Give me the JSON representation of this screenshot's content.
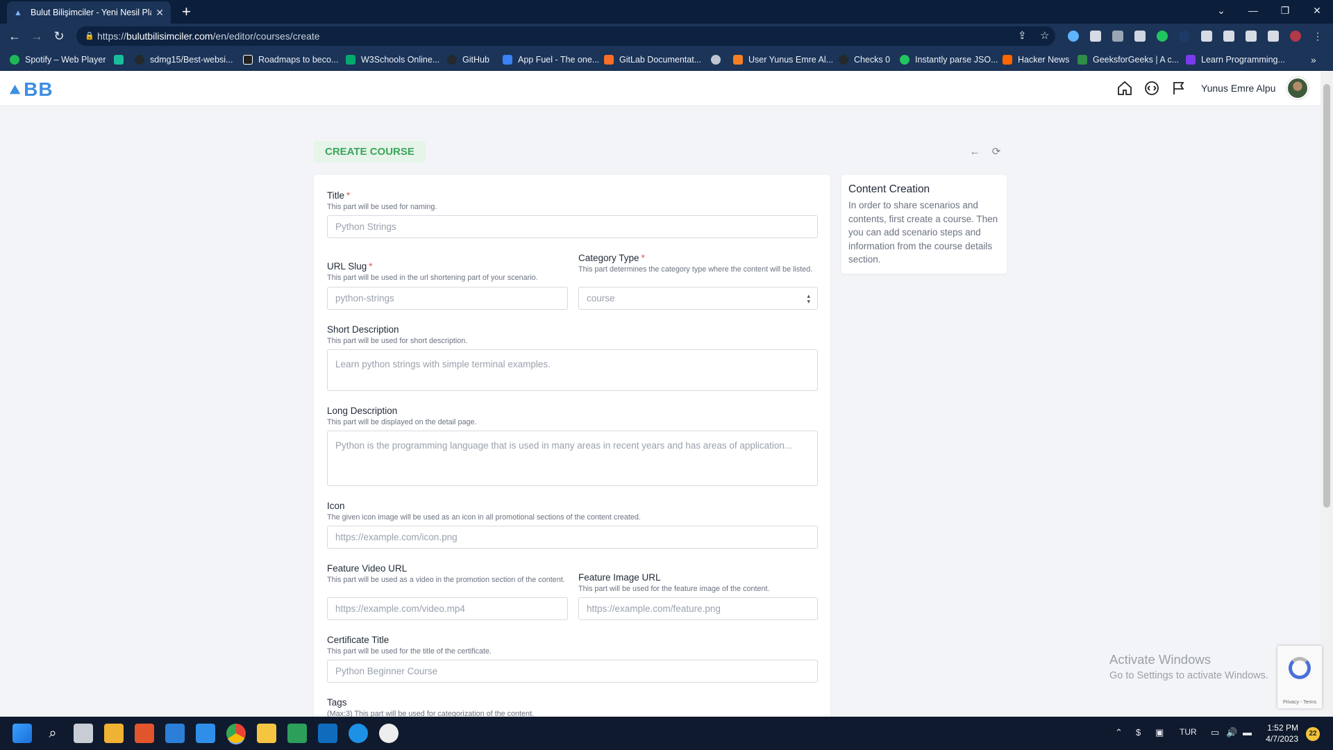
{
  "browser": {
    "tab_title": "Bulut Bilişimciler - Yeni Nesil Platf",
    "url_prefix": "https://",
    "url_host": "bulutbilisimciler.com",
    "url_path": "/en/editor/courses/create",
    "bookmarks": [
      {
        "label": "Spotify – Web Player",
        "color": "#1db954"
      },
      {
        "label": "",
        "color": "#1abc9c"
      },
      {
        "label": "sdmg15/Best-websi...",
        "color": "#24292e"
      },
      {
        "label": "Roadmaps to beco...",
        "color": "#222222"
      },
      {
        "label": "W3Schools Online...",
        "color": "#04aa6d"
      },
      {
        "label": "GitHub",
        "color": "#24292e"
      },
      {
        "label": "App Fuel - The one...",
        "color": "#3b82f6"
      },
      {
        "label": "GitLab Documentat...",
        "color": "#fc6d26"
      },
      {
        "label": "",
        "color": "#c0c7d2"
      },
      {
        "label": "User Yunus Emre Al...",
        "color": "#f48024"
      },
      {
        "label": "Checks 0",
        "color": "#24292e"
      },
      {
        "label": "Instantly parse JSO...",
        "color": "#22c55e"
      },
      {
        "label": "Hacker News",
        "color": "#ff6600"
      },
      {
        "label": "GeeksforGeeks | A c...",
        "color": "#2f8d46"
      },
      {
        "label": "Learn Programming...",
        "color": "#7c3aed"
      }
    ]
  },
  "app": {
    "logo_text": "BB",
    "user_name": "Yunus Emre Alpu",
    "page_badge": "CREATE COURSE",
    "form": {
      "title_label": "Title",
      "title_hint": "This part will be used for naming.",
      "title_placeholder": "Python Strings",
      "slug_label": "URL Slug",
      "slug_hint": "This part will be used in the url shortening part of your scenario.",
      "slug_placeholder": "python-strings",
      "category_label": "Category Type",
      "category_hint": "This part determines the category type where the content will be listed.",
      "category_value": "course",
      "short_label": "Short Description",
      "short_hint": "This part will be used for short description.",
      "short_placeholder": "Learn python strings with simple terminal examples.",
      "long_label": "Long Description",
      "long_hint": "This part will be displayed on the detail page.",
      "long_placeholder": "Python is the programming language that is used in many areas in recent years and has areas of application...",
      "icon_label": "Icon",
      "icon_hint": "The given icon image will be used as an icon in all promotional sections of the content created.",
      "icon_placeholder": "https://example.com/icon.png",
      "video_label": "Feature Video URL",
      "video_hint": "This part will be used as a video in the promotion section of the content.",
      "video_placeholder": "https://example.com/video.mp4",
      "image_label": "Feature Image URL",
      "image_hint": "This part will be used for the feature image of the content.",
      "image_placeholder": "https://example.com/feature.png",
      "cert_label": "Certificate Title",
      "cert_hint": "This part will be used for the title of the certificate.",
      "cert_placeholder": "Python Beginner Course",
      "tags_label": "Tags",
      "tags_hint": "(Max:3) This part will be used for categorization of the content."
    },
    "side": {
      "title": "Content Creation",
      "text": "In order to share scenarios and contents, first create a course. Then you can add scenario steps and information from the course details section."
    }
  },
  "windows": {
    "watermark_title": "Activate Windows",
    "watermark_sub": "Go to Settings to activate Windows.",
    "recaptcha_text": "Privacy - Terms",
    "language": "TUR",
    "time": "1:52 PM",
    "date": "4/7/2023",
    "notification_count": "22"
  }
}
